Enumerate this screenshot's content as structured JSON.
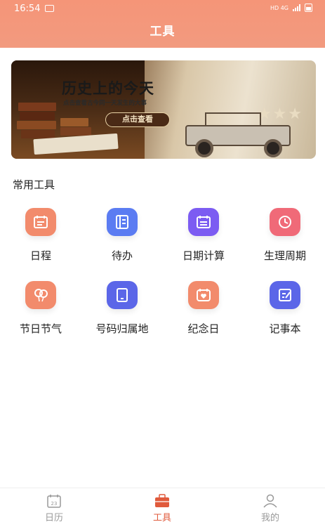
{
  "status_bar": {
    "time": "16:54",
    "network_labels": "HD  4G"
  },
  "header": {
    "title": "工具"
  },
  "banner": {
    "headline": "历史上的今天",
    "subtitle": "点击查看古今同一天发生的大事",
    "button_label": "点击查看"
  },
  "section": {
    "title": "常用工具"
  },
  "tools": [
    {
      "label": "日程",
      "icon": "calendar-icon",
      "color": "#f28b6c"
    },
    {
      "label": "待办",
      "icon": "notebook-icon",
      "color": "#5b7cf2"
    },
    {
      "label": "日期计算",
      "icon": "date-calc-icon",
      "color": "#7c5cf2"
    },
    {
      "label": "生理周期",
      "icon": "cycle-clock-icon",
      "color": "#f06a78"
    },
    {
      "label": "节日节气",
      "icon": "balloons-icon",
      "color": "#f28b6c"
    },
    {
      "label": "号码归属地",
      "icon": "phone-icon",
      "color": "#5b66e8"
    },
    {
      "label": "纪念日",
      "icon": "heart-calendar-icon",
      "color": "#f28b6c"
    },
    {
      "label": "记事本",
      "icon": "note-edit-icon",
      "color": "#5b66e8"
    }
  ],
  "tabbar": {
    "items": [
      {
        "label": "日历",
        "icon": "calendar-tab-icon",
        "active": false
      },
      {
        "label": "工具",
        "icon": "toolbox-icon",
        "active": true
      },
      {
        "label": "我的",
        "icon": "user-icon",
        "active": false
      }
    ]
  },
  "colors": {
    "header": "#f59578",
    "active_tab": "#e05a3c",
    "inactive_tab": "#999999"
  }
}
